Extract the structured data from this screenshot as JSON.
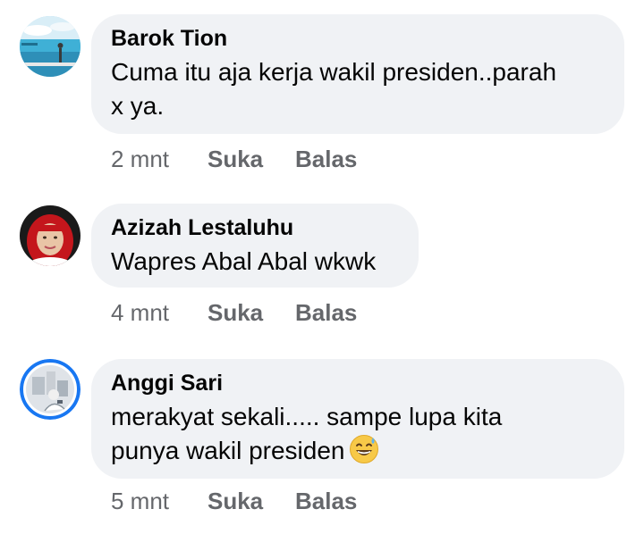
{
  "comments": [
    {
      "author": "Barok Tion",
      "text_lines": [
        "Cuma itu aja kerja wakil presiden..parah",
        "x ya."
      ],
      "time": "2 mnt",
      "like_label": "Suka",
      "reply_label": "Balas",
      "avatar_icon": "beach-photo-avatar"
    },
    {
      "author": "Azizah Lestaluhu",
      "text_lines": [
        "Wapres Abal Abal wkwk"
      ],
      "time": "4 mnt",
      "like_label": "Suka",
      "reply_label": "Balas",
      "avatar_icon": "woman-red-hijab-avatar"
    },
    {
      "author": "Anggi Sari",
      "text_lines": [
        "merakyat sekali..... sampe lupa kita",
        "punya wakil presiden"
      ],
      "emoji": "grinning-sweat-emoji",
      "time": "5 mnt",
      "like_label": "Suka",
      "reply_label": "Balas",
      "avatar_icon": "story-ring-avatar"
    }
  ],
  "colors": {
    "bubble": "#f0f2f5",
    "text": "#050505",
    "meta": "#65676b",
    "story_ring": "#1877f2"
  }
}
